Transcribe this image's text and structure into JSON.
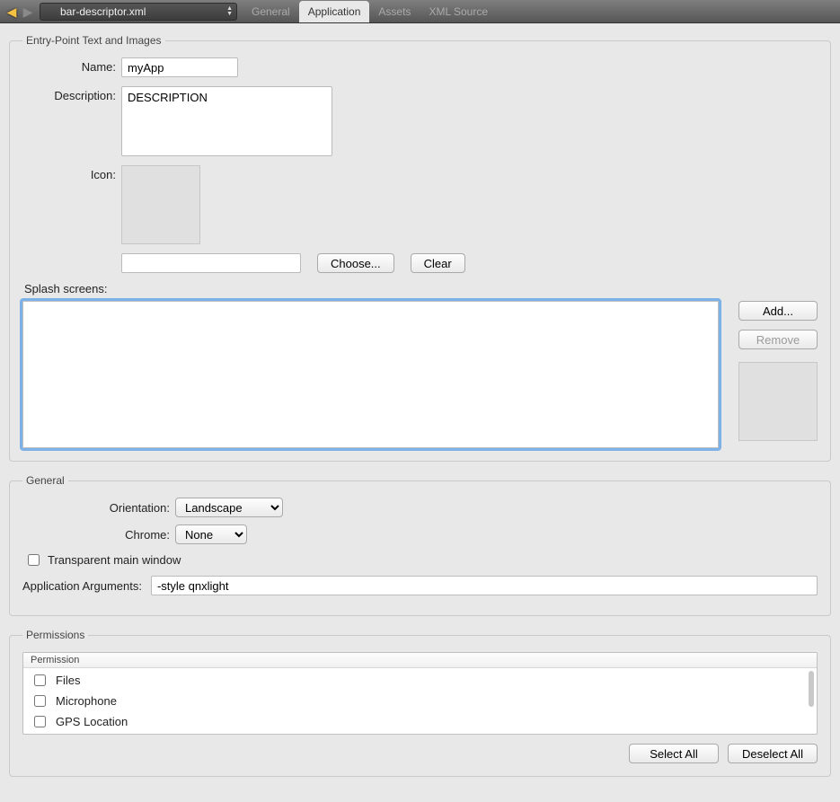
{
  "toolbar": {
    "filename": "bar-descriptor.xml",
    "tabs": [
      "General",
      "Application",
      "Assets",
      "XML Source"
    ],
    "active_tab_index": 1
  },
  "entry_point": {
    "legend": "Entry-Point Text and Images",
    "labels": {
      "name": "Name:",
      "description": "Description:",
      "icon": "Icon:",
      "splash": "Splash screens:"
    },
    "name_value": "myApp",
    "description_value": "DESCRIPTION",
    "icon_path_value": "",
    "buttons": {
      "choose": "Choose...",
      "clear": "Clear",
      "add": "Add...",
      "remove": "Remove"
    }
  },
  "general": {
    "legend": "General",
    "labels": {
      "orientation": "Orientation:",
      "chrome": "Chrome:",
      "transparent": "Transparent main window",
      "args": "Application Arguments:"
    },
    "orientation_value": "Landscape",
    "chrome_value": "None",
    "arguments_value": "-style qnxlight",
    "transparent_checked": false
  },
  "permissions": {
    "legend": "Permissions",
    "header": "Permission",
    "items": [
      {
        "label": "Files",
        "checked": false
      },
      {
        "label": "Microphone",
        "checked": false
      },
      {
        "label": "GPS Location",
        "checked": false
      }
    ],
    "buttons": {
      "select_all": "Select All",
      "deselect_all": "Deselect All"
    }
  }
}
